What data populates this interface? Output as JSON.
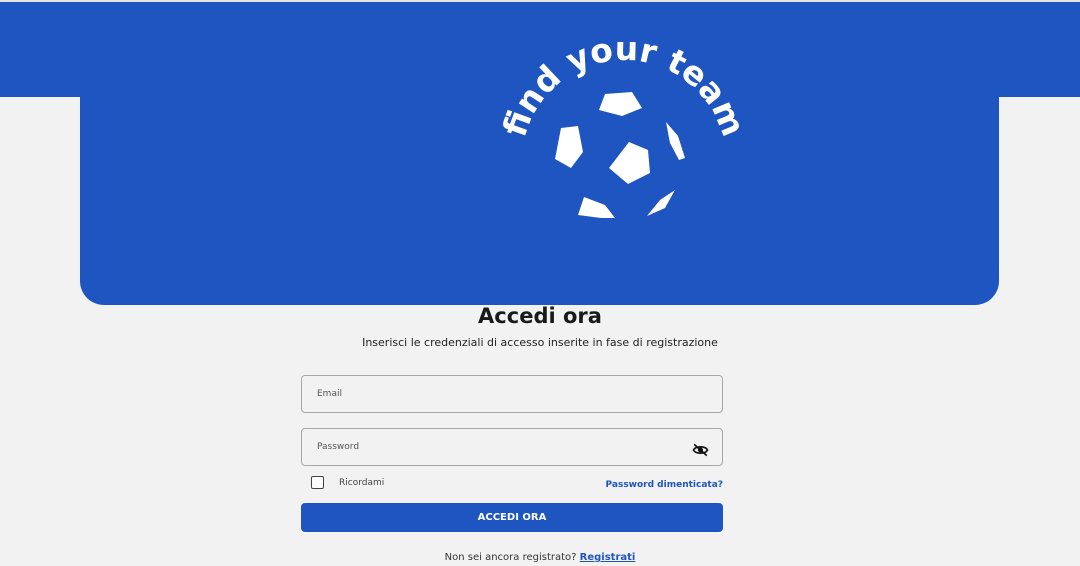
{
  "brand": {
    "logo_text": "find your team",
    "color": "#1e55c0"
  },
  "login": {
    "title": "Accedi ora",
    "subtitle": "Inserisci le credenziali di accesso inserite in fase di registrazione",
    "email_placeholder": "Email",
    "password_placeholder": "Password",
    "password_toggle_icon": "eye-off-icon",
    "remember_label": "Ricordami",
    "remember_checked": false,
    "forgot_label": "Password dimenticata?",
    "submit_label": "ACCEDI ORA",
    "signup_prompt": "Non sei ancora registrato?",
    "signup_link": "Registrati"
  }
}
